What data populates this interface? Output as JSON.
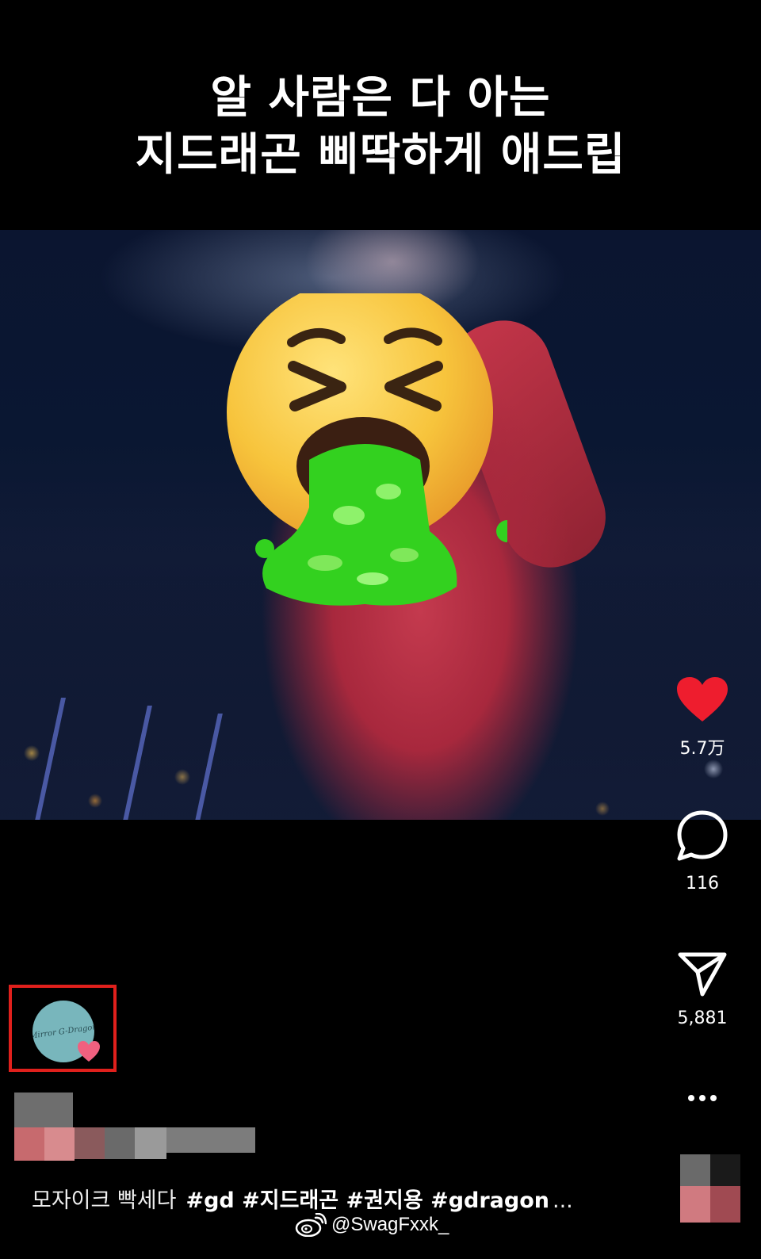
{
  "overlay": {
    "title_line1": "알 사람은 다 아는",
    "title_line2": "지드래곤 삐딱하게 애드립"
  },
  "video": {
    "sticker": "nauseated-face-emoji"
  },
  "actions": {
    "like": {
      "icon": "heart-icon",
      "count": "5.7万",
      "color": "#ee1d2e"
    },
    "comment": {
      "icon": "comment-bubble-icon",
      "count": "116"
    },
    "share": {
      "icon": "paper-plane-icon",
      "count": "5,881"
    },
    "more": {
      "icon": "more-dots-icon",
      "label": "…"
    }
  },
  "author": {
    "avatar_text": "Mirror G-Dragon",
    "highlight_color": "#e0201c"
  },
  "caption": {
    "text": "모자이크 빡세다",
    "hashtags": "#gd #지드래곤 #권지용 #gdragon",
    "more": "..."
  },
  "watermark": {
    "icon": "weibo-icon",
    "handle": "@SwagFxxk_"
  }
}
